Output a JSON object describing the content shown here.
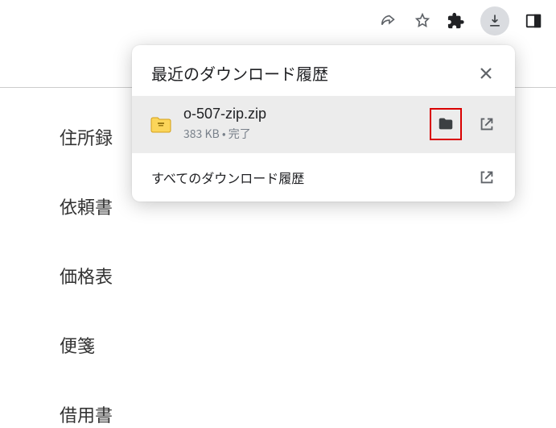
{
  "toolbar": {
    "share_icon": "share",
    "star_icon": "star",
    "extensions_icon": "puzzle",
    "downloads_icon": "download",
    "side_panel_icon": "side-panel"
  },
  "sidebar": {
    "items": [
      {
        "label": "住所録"
      },
      {
        "label": "依頼書"
      },
      {
        "label": "価格表"
      },
      {
        "label": "便箋"
      },
      {
        "label": "借用書"
      }
    ]
  },
  "popup": {
    "title": "最近のダウンロード履歴",
    "close_icon": "close",
    "item": {
      "file_name": "o-507-zip.zip",
      "file_size": "383 KB",
      "separator": " • ",
      "status": "完了",
      "zip_icon": "zip-file",
      "folder_icon": "folder",
      "open_icon": "open-new"
    },
    "footer": {
      "all_downloads_label": "すべてのダウンロード履歴",
      "open_icon": "open-new"
    }
  }
}
